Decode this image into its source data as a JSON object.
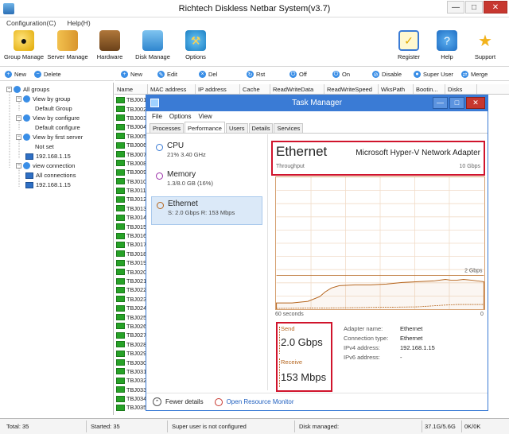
{
  "window": {
    "title": "Richtech Diskless Netbar System(v3.7)"
  },
  "menu": [
    "Configuration(C)",
    "Help(H)"
  ],
  "toolbar": [
    {
      "label": "Group Manage",
      "icon": "group-icon"
    },
    {
      "label": "Server Manage",
      "icon": "server-icon"
    },
    {
      "label": "Hardware",
      "icon": "hardware-icon"
    },
    {
      "label": "Disk Manage",
      "icon": "disk-icon"
    },
    {
      "label": "Options",
      "icon": "options-icon"
    },
    {
      "label": "Register",
      "icon": "register-icon"
    },
    {
      "label": "Help",
      "icon": "help-icon"
    },
    {
      "label": "Support",
      "icon": "support-icon"
    }
  ],
  "left_actions": {
    "new": "New",
    "delete": "Delete"
  },
  "tree": {
    "all_groups": "All groups",
    "view_by_group": "View by group",
    "default_group": "Default Group",
    "view_by_configure": "View by configure",
    "default_configure": "Default configure",
    "view_by_first_server": "View by first server",
    "not_set": "Not set",
    "server_ip": "192.168.1.15",
    "view_connection": "view connection",
    "all_connections": "All connections",
    "conn_ip": "192.168.1.15"
  },
  "right_actions": [
    "New",
    "Edit",
    "Del",
    "Rst",
    "Off",
    "On",
    "Disable",
    "Super User",
    "Merge"
  ],
  "columns": [
    "Name",
    "MAC address",
    "IP address",
    "Cache",
    "ReadWriteData",
    "ReadWriteSpeed",
    "WksPath",
    "Bootin...",
    "Disks"
  ],
  "machines": [
    "TBJ001",
    "TBJ002",
    "TBJ003",
    "TBJ004",
    "TBJ005",
    "TBJ006",
    "TBJ007",
    "TBJ008",
    "TBJ009",
    "TBJ010",
    "TBJ011",
    "TBJ012",
    "TBJ013",
    "TBJ014",
    "TBJ015",
    "TBJ016",
    "TBJ017",
    "TBJ018",
    "TBJ019",
    "TBJ020",
    "TBJ021",
    "TBJ022",
    "TBJ023",
    "TBJ024",
    "TBJ025",
    "TBJ026",
    "TBJ027",
    "TBJ028",
    "TBJ029",
    "TBJ030",
    "TBJ031",
    "TBJ032",
    "TBJ033",
    "TBJ034",
    "TBJ035"
  ],
  "statusbar": {
    "total": "Total: 35",
    "started": "Started: 35",
    "super_user": "Super user is not configured",
    "disk_managed": "Disk managed:",
    "disk_size": "37.1G/5.6G",
    "rate": "0K/0K"
  },
  "taskmgr": {
    "title": "Task Manager",
    "menu": [
      "File",
      "Options",
      "View"
    ],
    "tabs": [
      "Processes",
      "Performance",
      "Users",
      "Details",
      "Services"
    ],
    "active_tab": "Performance",
    "resources": [
      {
        "name": "CPU",
        "sub": "21%  3.40 GHz",
        "color": "#3a7bd5"
      },
      {
        "name": "Memory",
        "sub": "1.3/8.0 GB (16%)",
        "color": "#9b2fa8"
      },
      {
        "name": "Ethernet",
        "sub": "S: 2.0 Gbps  R: 153 Mbps",
        "color": "#b5651d"
      }
    ],
    "header": {
      "name": "Ethernet",
      "adapter": "Microsoft Hyper-V Network Adapter",
      "throughput_label": "Throughput",
      "max": "10 Gbps"
    },
    "graph": {
      "marker": "2 Gbps",
      "left_label": "60 seconds",
      "right_label": "0",
      "color": "#b5651d"
    },
    "send": {
      "label": "Send",
      "value": "2.0 Gbps"
    },
    "receive": {
      "label": "Receive",
      "value": "153 Mbps"
    },
    "props": [
      {
        "k": "Adapter name:",
        "v": "Ethernet"
      },
      {
        "k": "Connection type:",
        "v": "Ethernet"
      },
      {
        "k": "IPv4 address:",
        "v": "192.168.1.15"
      },
      {
        "k": "IPv6 address:",
        "v": "-"
      }
    ],
    "footer": {
      "fewer": "Fewer details",
      "monitor": "Open Resource Monitor"
    }
  }
}
